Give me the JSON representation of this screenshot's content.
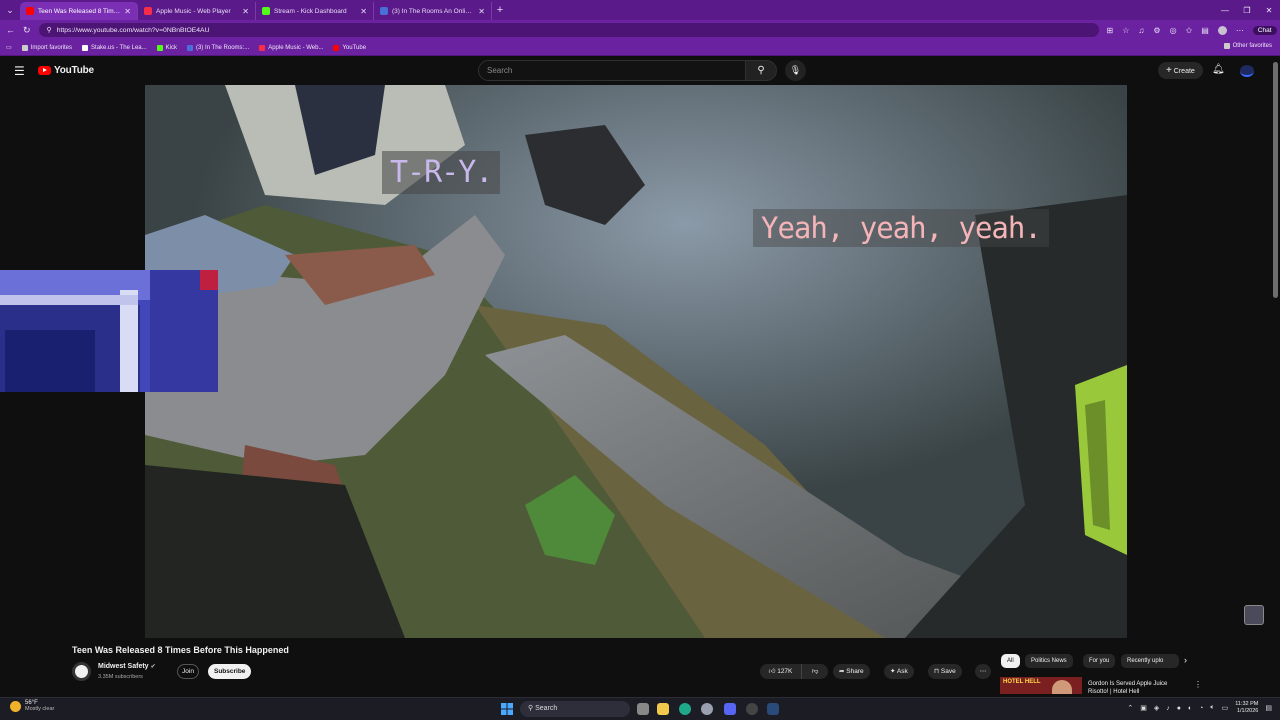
{
  "browser": {
    "tabs": [
      {
        "label": "Teen Was Released 8 Times B",
        "favicon_color": "#ff0000",
        "active": true
      },
      {
        "label": "Apple Music - Web Player",
        "favicon_color": "#fa2d48",
        "active": false
      },
      {
        "label": "Stream - Kick Dashboard",
        "favicon_color": "#53fc18",
        "active": false
      },
      {
        "label": "(3) In The Rooms An Online Addic",
        "favicon_color": "#4a6fd8",
        "active": false
      }
    ],
    "url": "https://www.youtube.com/watch?v=0NBnBtOE4AU",
    "chat_label": "Chat",
    "bookmarks": [
      {
        "label": "Import favorites",
        "color": "#cccccc"
      },
      {
        "label": "Stake.us - The Lea...",
        "color": "#ffffff"
      },
      {
        "label": "Kick",
        "color": "#53fc18"
      },
      {
        "label": "(3) In The Rooms:...",
        "color": "#4a6fd8"
      },
      {
        "label": "Apple Music - Web...",
        "color": "#fa2d48"
      },
      {
        "label": "YouTube",
        "color": "#ff0000"
      }
    ],
    "other_favorites": "Other favorites"
  },
  "youtube": {
    "logo_text": "YouTube",
    "search_placeholder": "Search",
    "create_label": "Create"
  },
  "video": {
    "caption_top": "T-R-Y.",
    "caption_right": "Yeah, yeah, yeah.",
    "title": "Teen Was Released 8 Times Before This Happened",
    "channel": "Midwest Safety",
    "subscribers": "3.35M subscribers",
    "join_label": "Join",
    "subscribe_label": "Subscribe",
    "likes": "127K",
    "share_label": "Share",
    "ask_label": "Ask",
    "save_label": "Save"
  },
  "chips": [
    {
      "label": "All",
      "active": true
    },
    {
      "label": "Politics News",
      "active": false
    },
    {
      "label": "For you",
      "active": false
    },
    {
      "label": "Recently uplo",
      "active": false
    }
  ],
  "recommendation": {
    "thumb_text": "HOTEL HELL",
    "title": "Gordon Is Served Apple Juice Risotto! | Hotel Hell"
  },
  "taskbar": {
    "temperature": "56°F",
    "weather": "Mostly clear",
    "search_label": "Search",
    "time": "11:32 PM",
    "date": "1/1/2026"
  },
  "colors": {
    "browser_accent": "#6a22a0",
    "youtube_red": "#ff0000",
    "caption_purple": "#c9b8ec",
    "caption_pink": "#f5b4b8"
  }
}
